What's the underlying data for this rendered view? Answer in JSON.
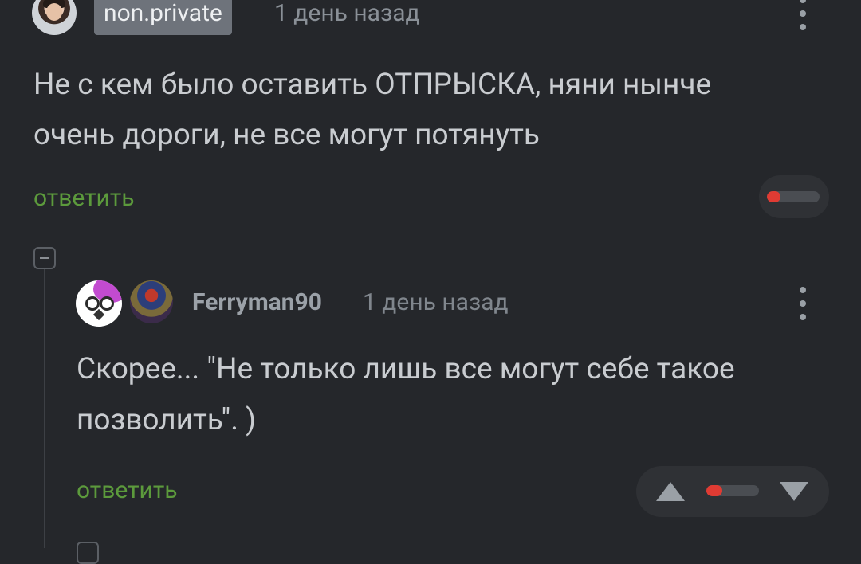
{
  "comments": [
    {
      "username": "non.private",
      "time": "1 день назад",
      "text": "Не с кем было оставить ОТПРЫСКА, няни нынче очень дороги, не все могут потянуть",
      "reply_label": "ответить",
      "rating_fraction": 0.25
    },
    {
      "username": "Ferryman90",
      "time": "1 день назад",
      "text": "Скорее... \"Не только лишь все могут себе такое позволить\". )",
      "reply_label": "ответить",
      "rating_fraction": 0.3
    }
  ],
  "colors": {
    "background": "#25272b",
    "reply_link": "#5c9a3c",
    "rating_negative": "#e03b33",
    "username_badge": "#6e737b"
  },
  "icons": [
    "more-vertical-icon",
    "collapse-minus-icon",
    "upvote-arrow-icon",
    "downvote-arrow-icon"
  ]
}
